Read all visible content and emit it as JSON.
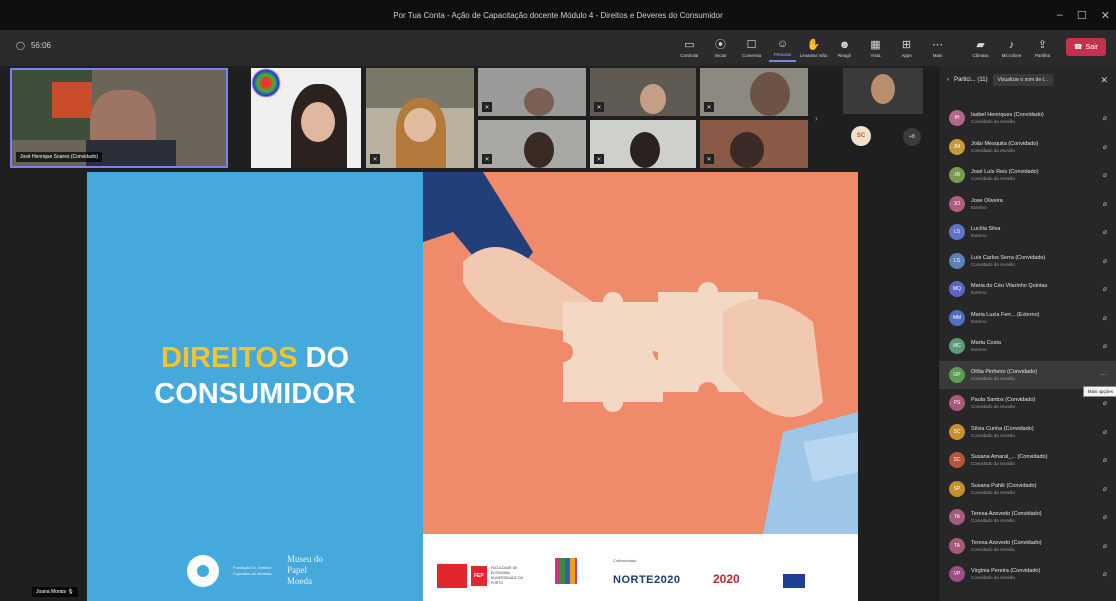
{
  "window": {
    "title": "Por Tua Conta - Ação de Capacitação docente Módulo 4 - Direitos e Deveres do Consumidor"
  },
  "toolbar": {
    "timer": "56:06",
    "items": [
      {
        "label": "Controlar",
        "icon": "control-icon"
      },
      {
        "label": "Iniciar",
        "icon": "record-icon"
      },
      {
        "label": "Conversa",
        "icon": "chat-icon"
      },
      {
        "label": "Pessoas",
        "icon": "people-icon"
      },
      {
        "label": "Levantar mão",
        "icon": "hand-icon"
      },
      {
        "label": "Reagir",
        "icon": "react-icon"
      },
      {
        "label": "Vista",
        "icon": "view-icon"
      },
      {
        "label": "Apps",
        "icon": "apps-icon"
      },
      {
        "label": "Mais",
        "icon": "more-icon"
      },
      {
        "label": "Câmara",
        "icon": "camera-icon"
      },
      {
        "label": "Microfone",
        "icon": "mic-icon"
      },
      {
        "label": "Partilha",
        "icon": "share-icon"
      }
    ],
    "leave_label": "Sair"
  },
  "stage": {
    "presenter_name": "José Henrique Soares (Convidado)",
    "bottom_name": "Joana Morais",
    "overflow_avatar": "SC",
    "overflow_count": "+8"
  },
  "slide": {
    "title_highlight": "DIREITOS",
    "title_rest": " DO",
    "title_line2": "CONSUMIDOR",
    "foundation": "Fundação Dr. António Cupertino de Miranda",
    "museum": "Museu do Papel Moeda",
    "fep_tag": "FEP",
    "fep_text": "FACULDADE DE ECONOMIA UNIVERSIDADE DO PORTO",
    "cofinanced": "Cofinanciado",
    "norte": "NORTE2020",
    "portugal2020": "2020"
  },
  "panel": {
    "title": "Partici... (11)",
    "action_label": "Visualizar o som de t...",
    "tooltip": "Mais opções",
    "participants": [
      {
        "initials": "IH",
        "name": "Isabel Henriques (Convidado)",
        "role": "Convidado da reunião",
        "color": "#b2668a"
      },
      {
        "initials": "JM",
        "name": "João Mesquita (Convidado)",
        "role": "Convidado da reunião",
        "color": "#c49a3a"
      },
      {
        "initials": "JR",
        "name": "José Luís Reis (Convidado)",
        "role": "Convidado da reunião",
        "color": "#7a9a53"
      },
      {
        "initials": "JO",
        "name": "Jose Oliveira",
        "role": "Externo",
        "color": "#b05b7f"
      },
      {
        "initials": "LS",
        "name": "Lucília Silva",
        "role": "Externo",
        "color": "#6273c7"
      },
      {
        "initials": "LS",
        "name": "Luís Carlos Serra (Convidado)",
        "role": "Convidado da reunião",
        "color": "#5d80b8"
      },
      {
        "initials": "MQ",
        "name": "Maria do Céu Vilarinho Quintas",
        "role": "Externo",
        "color": "#5b66c4"
      },
      {
        "initials": "MM",
        "name": "Maria Luzia Ferr... (Externo)",
        "role": "Externo",
        "color": "#4e6fc2"
      },
      {
        "initials": "MC",
        "name": "Marta Costa",
        "role": "Externo",
        "color": "#599a78"
      },
      {
        "initials": "OP",
        "name": "Otília Pinheiro (Convidado)",
        "role": "Convidado da reunião",
        "color": "#5d9a54"
      },
      {
        "initials": "PS",
        "name": "Paula Santos (Convidado)",
        "role": "Convidado da reunião",
        "color": "#a8577d"
      },
      {
        "initials": "SC",
        "name": "Sílvia Cunha (Convidado)",
        "role": "Convidado da reunião",
        "color": "#c7902f"
      },
      {
        "initials": "SC",
        "name": "Susana Amaral_... (Convidado)",
        "role": "Convidado da reunião",
        "color": "#b6553b"
      },
      {
        "initials": "SP",
        "name": "Susana Pahlk (Convidado)",
        "role": "Convidado da reunião",
        "color": "#c28f2e"
      },
      {
        "initials": "TA",
        "name": "Teresa Azevedo (Convidado)",
        "role": "Convidado da reunião",
        "color": "#a35a7c"
      },
      {
        "initials": "TA",
        "name": "Teresa Azevedo (Convidado)",
        "role": "Convidado da reunião",
        "color": "#a35a7c"
      },
      {
        "initials": "VP",
        "name": "Virgínia Pereira (Convidado)",
        "role": "Convidado da reunião",
        "color": "#9a4f86"
      }
    ]
  }
}
